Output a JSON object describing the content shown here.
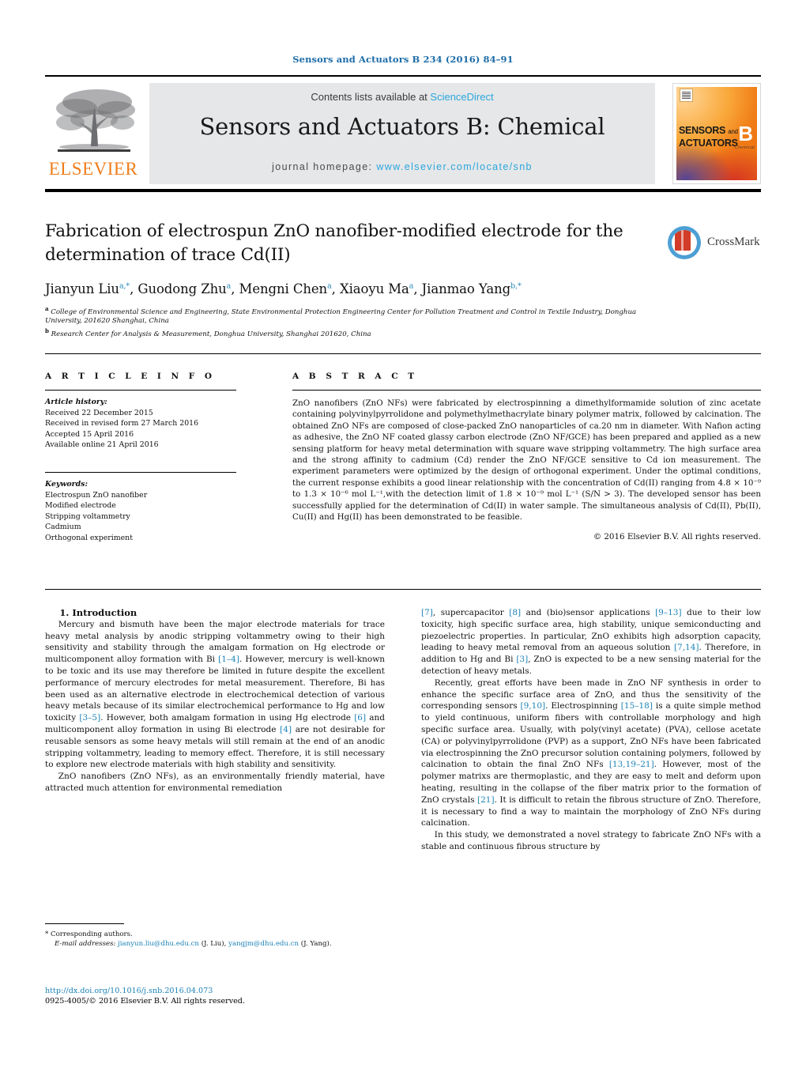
{
  "header": {
    "running_head": "Sensors and Actuators B 234 (2016) 84–91",
    "contents_prefix": "Contents lists available at ",
    "contents_link": "ScienceDirect",
    "journal_title": "Sensors and Actuators B: Chemical",
    "homepage_label": "journal homepage: ",
    "homepage_url": "www.elsevier.com/locate/snb",
    "publisher_name": "ELSEVIER",
    "cover_line1": "SENSORS",
    "cover_and": "and",
    "cover_line2": "ACTUATORS",
    "cover_letter": "B",
    "cover_sub": "Chemical",
    "crossmark_label": "CrossMark"
  },
  "article": {
    "title": "Fabrication of electrospun ZnO nanofiber-modified electrode for the determination of trace Cd(II)",
    "authors_html": "Jianyun Liu<sup>a,*</sup>, Guodong Zhu<sup>a</sup>, Mengni Chen<sup>a</sup>, Xiaoyu Ma<sup>a</sup>, Jianmao Yang<sup>b,*</sup>",
    "affiliation_a": "College of Environmental Science and Engineering, State Environmental Protection Engineering Center for Pollution Treatment and Control in Textile Industry, Donghua University, 201620 Shanghai, China",
    "affiliation_b": "Research Center for Analysis & Measurement, Donghua University, Shanghai 201620, China"
  },
  "info": {
    "heading": "A R T I C L E   I N F O",
    "history_label": "Article history:",
    "history": [
      "Received 22 December 2015",
      "Received in revised form 27 March 2016",
      "Accepted 15 April 2016",
      "Available online 21 April 2016"
    ],
    "keywords_label": "Keywords:",
    "keywords": [
      "Electrospun ZnO nanofiber",
      "Modified electrode",
      "Stripping voltammetry",
      "Cadmium",
      "Orthogonal experiment"
    ]
  },
  "abstract": {
    "heading": "A B S T R A C T",
    "text": "ZnO nanofibers (ZnO NFs) were fabricated by electrospinning a dimethylformamide solution of zinc acetate containing polyvinylpyrrolidone and polymethylmethacrylate binary polymer matrix, followed by calcination. The obtained ZnO NFs are composed of close-packed ZnO nanoparticles of ca.20 nm in diameter. With Nafion acting as adhesive, the ZnO NF coated glassy carbon electrode (ZnO NF/GCE) has been prepared and applied as a new sensing platform for heavy metal determination with square wave stripping voltammetry. The high surface area and the strong affinity to cadmium (Cd) render the ZnO NF/GCE sensitive to Cd ion measurement. The experiment parameters were optimized by the design of orthogonal experiment. Under the optimal conditions, the current response exhibits a good linear relationship with the concentration of Cd(II) ranging from 4.8 × 10⁻⁹ to 1.3 × 10⁻⁶ mol L⁻¹,with the detection limit of 1.8 × 10⁻⁹ mol L⁻¹ (S/N > 3). The developed sensor has been successfully applied for the determination of Cd(II) in water sample. The simultaneous analysis of Cd(II), Pb(II), Cu(II) and Hg(II) has been demonstrated to be feasible.",
    "copyright": "© 2016 Elsevier B.V. All rights reserved."
  },
  "intro": {
    "heading": "1.  Introduction",
    "left_p1_html": "Mercury and bismuth have been the major electrode materials for trace heavy metal analysis by anodic stripping voltammetry owing to their high sensitivity and stability through the amalgam formation on Hg electrode or multicomponent alloy formation with Bi <span class=\"ref\">[1–4]</span>. However, mercury is well-known to be toxic and its use may therefore be limited in future despite the excellent performance of mercury electrodes for metal measurement. Therefore, Bi has been used as an alternative electrode in electrochemical detection of various heavy metals because of its similar electrochemical performance to Hg and low toxicity <span class=\"ref\">[3–5]</span>. However, both amalgam formation in using Hg electrode <span class=\"ref\">[6]</span> and multicomponent alloy formation in using Bi electrode <span class=\"ref\">[4]</span> are not desirable for reusable sensors as some heavy metals will still remain at the end of an anodic stripping voltammetry, leading to memory effect. Therefore, it is still necessary to explore new electrode materials with high stability and sensitivity.",
    "left_p2_html": "ZnO nanofibers (ZnO NFs), as an environmentally friendly material, have attracted much attention for environmental remediation",
    "right_p1_html": "<span class=\"ref\">[7]</span>, supercapacitor <span class=\"ref\">[8]</span> and (bio)sensor applications <span class=\"ref\">[9–13]</span> due to their low toxicity, high specific surface area, high stability, unique semiconducting and piezoelectric properties. In particular, ZnO exhibits high adsorption capacity, leading to heavy metal removal from an aqueous solution <span class=\"ref\">[7,14]</span>. Therefore, in addition to Hg and Bi <span class=\"ref\">[3]</span>, ZnO is expected to be a new sensing material for the detection of heavy metals.",
    "right_p2_html": "Recently, great efforts have been made in ZnO NF synthesis in order to enhance the specific surface area of ZnO, and thus the sensitivity of the corresponding sensors <span class=\"ref\">[9,10]</span>. Electrospinning <span class=\"ref\">[15–18]</span> is a quite simple method to yield continuous, uniform fibers with controllable morphology and high specific surface area. Usually, with poly(vinyl acetate) (PVA), cellose acetate (CA) or polyvinylpyrrolidone (PVP) as a support, ZnO NFs have been fabricated via electrospinning the ZnO precursor solution containing polymers, followed by calcination to obtain the final ZnO NFs <span class=\"ref\">[13,19–21]</span>. However, most of the polymer matrixs are thermoplastic, and they are easy to melt and deform upon heating, resulting in the collapse of the fiber matrix prior to the formation of ZnO crystals <span class=\"ref\">[21]</span>. It is difficult to retain the fibrous structure of ZnO. Therefore, it is necessary to find a way to maintain the morphology of ZnO NFs during calcination.",
    "right_p3_html": "In this study, we demonstrated a novel strategy to fabricate ZnO NFs with a stable and continuous fibrous structure by"
  },
  "footer": {
    "corresponding_label": "*  Corresponding authors.",
    "email_label": "E-mail addresses:",
    "email1": "jianyun.liu@dhu.edu.cn",
    "email1_owner": "(J. Liu),",
    "email2": "yangjm@dhu.edu.cn",
    "email2_owner": "(J. Yang).",
    "doi": "http://dx.doi.org/10.1016/j.snb.2016.04.073",
    "issn_line": "0925-4005/© 2016 Elsevier B.V. All rights reserved."
  }
}
